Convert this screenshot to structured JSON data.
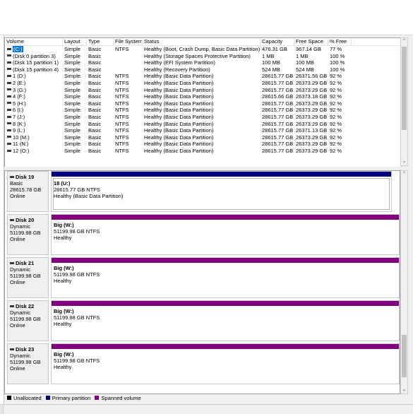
{
  "colors": {
    "unallocated": "#000000",
    "primary": "#00007f",
    "spanned": "#800080",
    "selection": "#0078d7"
  },
  "volume_list": {
    "columns": [
      "Volume",
      "Layout",
      "Type",
      "File System",
      "Status",
      "Capacity",
      "Free Space",
      "% Free"
    ],
    "rows": [
      {
        "volume": "(C:)",
        "layout": "Simple",
        "type": "Basic",
        "fs": "NTFS",
        "status": "Healthy (Boot, Crash Dump, Basic Data Partition)",
        "capacity": "476.31 GB",
        "free": "367.14 GB",
        "pct": "77 %",
        "selected": true
      },
      {
        "volume": "(Disk 0 partition 3)",
        "layout": "Simple",
        "type": "Basic",
        "fs": "",
        "status": "Healthy (Storage Spaces Protective Partition)",
        "capacity": "1 MB",
        "free": "1 MB",
        "pct": "100 %"
      },
      {
        "volume": "(Disk 15 partition 1)",
        "layout": "Simple",
        "type": "Basic",
        "fs": "",
        "status": "Healthy (EFI System Partition)",
        "capacity": "100 MB",
        "free": "100 MB",
        "pct": "100 %"
      },
      {
        "volume": "(Disk 15 partition 4)",
        "layout": "Simple",
        "type": "Basic",
        "fs": "",
        "status": "Healthy (Recovery Partition)",
        "capacity": "524 MB",
        "free": "524 MB",
        "pct": "100 %"
      },
      {
        "volume": "1 (D:)",
        "layout": "Simple",
        "type": "Basic",
        "fs": "NTFS",
        "status": "Healthy (Basic Data Partition)",
        "capacity": "28615.77 GB",
        "free": "26371.56 GB",
        "pct": "92 %"
      },
      {
        "volume": "2 (E:)",
        "layout": "Simple",
        "type": "Basic",
        "fs": "NTFS",
        "status": "Healthy (Basic Data Partition)",
        "capacity": "28615.77 GB",
        "free": "26373.29 GB",
        "pct": "92 %"
      },
      {
        "volume": "3 (G:)",
        "layout": "Simple",
        "type": "Basic",
        "fs": "NTFS",
        "status": "Healthy (Basic Data Partition)",
        "capacity": "28615.77 GB",
        "free": "26373.29 GB",
        "pct": "92 %"
      },
      {
        "volume": "4 (F:)",
        "layout": "Simple",
        "type": "Basic",
        "fs": "NTFS",
        "status": "Healthy (Basic Data Partition)",
        "capacity": "28615.66 GB",
        "free": "26373.18 GB",
        "pct": "92 %"
      },
      {
        "volume": "5 (H:)",
        "layout": "Simple",
        "type": "Basic",
        "fs": "NTFS",
        "status": "Healthy (Basic Data Partition)",
        "capacity": "28615.77 GB",
        "free": "26373.29 GB",
        "pct": "92 %"
      },
      {
        "volume": "6 (I:)",
        "layout": "Simple",
        "type": "Basic",
        "fs": "NTFS",
        "status": "Healthy (Basic Data Partition)",
        "capacity": "28615.77 GB",
        "free": "26373.29 GB",
        "pct": "92 %"
      },
      {
        "volume": "7 (J:)",
        "layout": "Simple",
        "type": "Basic",
        "fs": "NTFS",
        "status": "Healthy (Basic Data Partition)",
        "capacity": "28615.77 GB",
        "free": "26373.29 GB",
        "pct": "92 %"
      },
      {
        "volume": "8 (K:)",
        "layout": "Simple",
        "type": "Basic",
        "fs": "NTFS",
        "status": "Healthy (Basic Data Partition)",
        "capacity": "28615.77 GB",
        "free": "26373.29 GB",
        "pct": "92 %"
      },
      {
        "volume": "9 (L:)",
        "layout": "Simple",
        "type": "Basic",
        "fs": "NTFS",
        "status": "Healthy (Basic Data Partition)",
        "capacity": "28615.77 GB",
        "free": "26371.13 GB",
        "pct": "92 %"
      },
      {
        "volume": "10 (M:)",
        "layout": "Simple",
        "type": "Basic",
        "fs": "NTFS",
        "status": "Healthy (Basic Data Partition)",
        "capacity": "28615.77 GB",
        "free": "26373.29 GB",
        "pct": "92 %"
      },
      {
        "volume": "11 (N:)",
        "layout": "Simple",
        "type": "Basic",
        "fs": "NTFS",
        "status": "Healthy (Basic Data Partition)",
        "capacity": "28615.77 GB",
        "free": "26373.29 GB",
        "pct": "92 %"
      },
      {
        "volume": "12 (O:)",
        "layout": "Simple",
        "type": "Basic",
        "fs": "NTFS",
        "status": "Healthy (Basic Data Partition)",
        "capacity": "28615.77 GB",
        "free": "26373.29 GB",
        "pct": "92 %"
      }
    ]
  },
  "disks": [
    {
      "name": "Disk 19",
      "type": "Basic",
      "size": "28615.78 GB",
      "state": "Online",
      "partition_kind": "primary",
      "volume": "18 (U:)",
      "detail": "28615.77 GB NTFS",
      "status": "Healthy (Basic Data Partition)"
    },
    {
      "name": "Disk 20",
      "type": "Dynamic",
      "size": "51199.98 GB",
      "state": "Online",
      "partition_kind": "spanned",
      "volume": "Big (W:)",
      "detail": "51199.98 GB NTFS",
      "status": "Healthy"
    },
    {
      "name": "Disk 21",
      "type": "Dynamic",
      "size": "51199.98 GB",
      "state": "Online",
      "partition_kind": "spanned",
      "volume": "Big (W:)",
      "detail": "51199.98 GB NTFS",
      "status": "Healthy"
    },
    {
      "name": "Disk 22",
      "type": "Dynamic",
      "size": "51199.98 GB",
      "state": "Online",
      "partition_kind": "spanned",
      "volume": "Big (W:)",
      "detail": "51199.98 GB NTFS",
      "status": "Healthy"
    },
    {
      "name": "Disk 23",
      "type": "Dynamic",
      "size": "51199.98 GB",
      "state": "Online",
      "partition_kind": "spanned",
      "volume": "Big (W:)",
      "detail": "51199.98 GB NTFS",
      "status": "Healthy"
    }
  ],
  "legend": [
    {
      "label": "Unallocated",
      "color": "#000000"
    },
    {
      "label": "Primary partition",
      "color": "#00007f"
    },
    {
      "label": "Spanned volume",
      "color": "#800080"
    }
  ]
}
